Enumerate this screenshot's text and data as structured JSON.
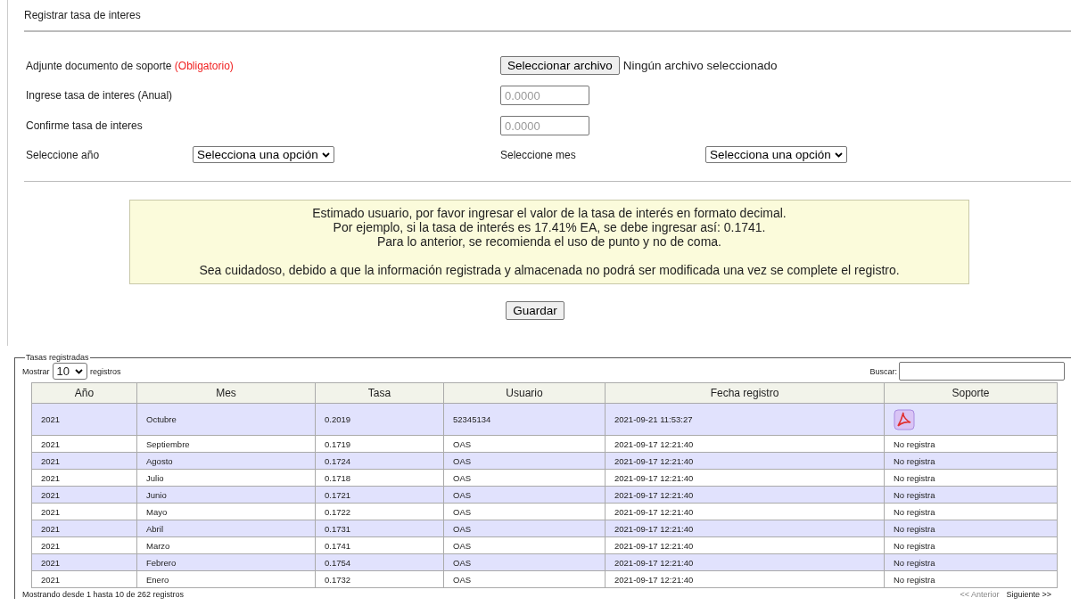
{
  "title": "Registrar tasa de interes",
  "form": {
    "attach_label": "Adjunte documento de soporte",
    "attach_required": "(Obligatorio)",
    "file_button": "Seleccionar archivo",
    "file_status": "Ningún archivo seleccionado",
    "rate_label": "Ingrese tasa de interes (Anual)",
    "rate_placeholder": "0.0000",
    "confirm_label": "Confirme tasa de interes",
    "confirm_placeholder": "0.0000",
    "year_label": "Seleccione año",
    "year_value": "Selecciona una opción",
    "month_label": "Seleccione mes",
    "month_value": "Selecciona una opción"
  },
  "notice": {
    "lines": [
      "Estimado usuario, por favor ingresar el valor de la tasa de interés en formato decimal.",
      "Por ejemplo, si la tasa de interés es 17.41% EA, se debe ingresar así: 0.1741.",
      "Para lo anterior, se recomienda el uso de punto y no de coma."
    ],
    "warning": "Sea cuidadoso, debido a que la información registrada y almacenada no podrá ser modificada una vez se complete el registro."
  },
  "save_button": "Guardar",
  "table_section": {
    "legend": "Tasas registradas",
    "show_label": "Mostrar",
    "page_size": "10",
    "records_label": "registros",
    "search_label": "Buscar:",
    "columns": [
      "Año",
      "Mes",
      "Tasa",
      "Usuario",
      "Fecha registro",
      "Soporte"
    ],
    "rows": [
      {
        "year": "2021",
        "month": "Octubre",
        "rate": "0.2019",
        "user": "52345134",
        "date": "2021-09-21 11:53:27",
        "support": {
          "kind": "pdf"
        }
      },
      {
        "year": "2021",
        "month": "Septiembre",
        "rate": "0.1719",
        "user": "OAS",
        "date": "2021-09-17 12:21:40",
        "support": {
          "kind": "text",
          "text": "No registra"
        }
      },
      {
        "year": "2021",
        "month": "Agosto",
        "rate": "0.1724",
        "user": "OAS",
        "date": "2021-09-17 12:21:40",
        "support": {
          "kind": "text",
          "text": "No registra"
        }
      },
      {
        "year": "2021",
        "month": "Julio",
        "rate": "0.1718",
        "user": "OAS",
        "date": "2021-09-17 12:21:40",
        "support": {
          "kind": "text",
          "text": "No registra"
        }
      },
      {
        "year": "2021",
        "month": "Junio",
        "rate": "0.1721",
        "user": "OAS",
        "date": "2021-09-17 12:21:40",
        "support": {
          "kind": "text",
          "text": "No registra"
        }
      },
      {
        "year": "2021",
        "month": "Mayo",
        "rate": "0.1722",
        "user": "OAS",
        "date": "2021-09-17 12:21:40",
        "support": {
          "kind": "text",
          "text": "No registra"
        }
      },
      {
        "year": "2021",
        "month": "Abril",
        "rate": "0.1731",
        "user": "OAS",
        "date": "2021-09-17 12:21:40",
        "support": {
          "kind": "text",
          "text": "No registra"
        }
      },
      {
        "year": "2021",
        "month": "Marzo",
        "rate": "0.1741",
        "user": "OAS",
        "date": "2021-09-17 12:21:40",
        "support": {
          "kind": "text",
          "text": "No registra"
        }
      },
      {
        "year": "2021",
        "month": "Febrero",
        "rate": "0.1754",
        "user": "OAS",
        "date": "2021-09-17 12:21:40",
        "support": {
          "kind": "text",
          "text": "No registra"
        }
      },
      {
        "year": "2021",
        "month": "Enero",
        "rate": "0.1732",
        "user": "OAS",
        "date": "2021-09-17 12:21:40",
        "support": {
          "kind": "text",
          "text": "No registra"
        }
      }
    ],
    "info": "Mostrando desde 1 hasta 10 de 262 registros",
    "pager": [
      {
        "label": "<< Anterior",
        "disabled": true
      },
      {
        "label": "Siguiente >>",
        "disabled": false
      }
    ]
  }
}
